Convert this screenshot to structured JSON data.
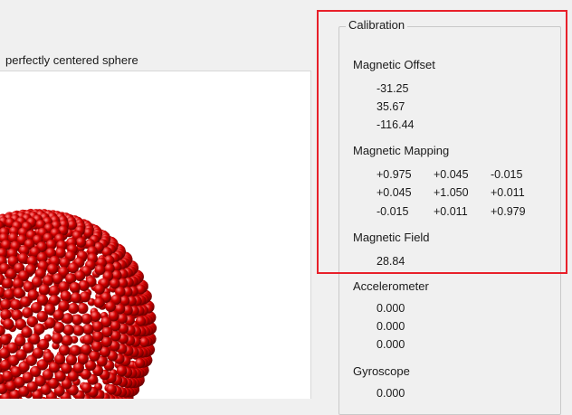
{
  "instruction": "perfectly centered sphere",
  "calibration": {
    "title": "Calibration",
    "magnetic_offset": {
      "title": "Magnetic Offset",
      "values": [
        "-31.25",
        "35.67",
        "-116.44"
      ]
    },
    "magnetic_mapping": {
      "title": "Magnetic Mapping",
      "rows": [
        [
          "+0.975",
          "+0.045",
          "-0.015"
        ],
        [
          "+0.045",
          "+1.050",
          "+0.011"
        ],
        [
          "-0.015",
          "+0.011",
          "+0.979"
        ]
      ]
    },
    "magnetic_field": {
      "title": "Magnetic Field",
      "value": "28.84"
    },
    "accelerometer": {
      "title": "Accelerometer",
      "values": [
        "0.000",
        "0.000",
        "0.000"
      ]
    },
    "gyroscope": {
      "title": "Gyroscope",
      "values": [
        "0.000"
      ]
    }
  },
  "colors": {
    "highlight": "#e8202a",
    "sphere": "#d40000"
  }
}
